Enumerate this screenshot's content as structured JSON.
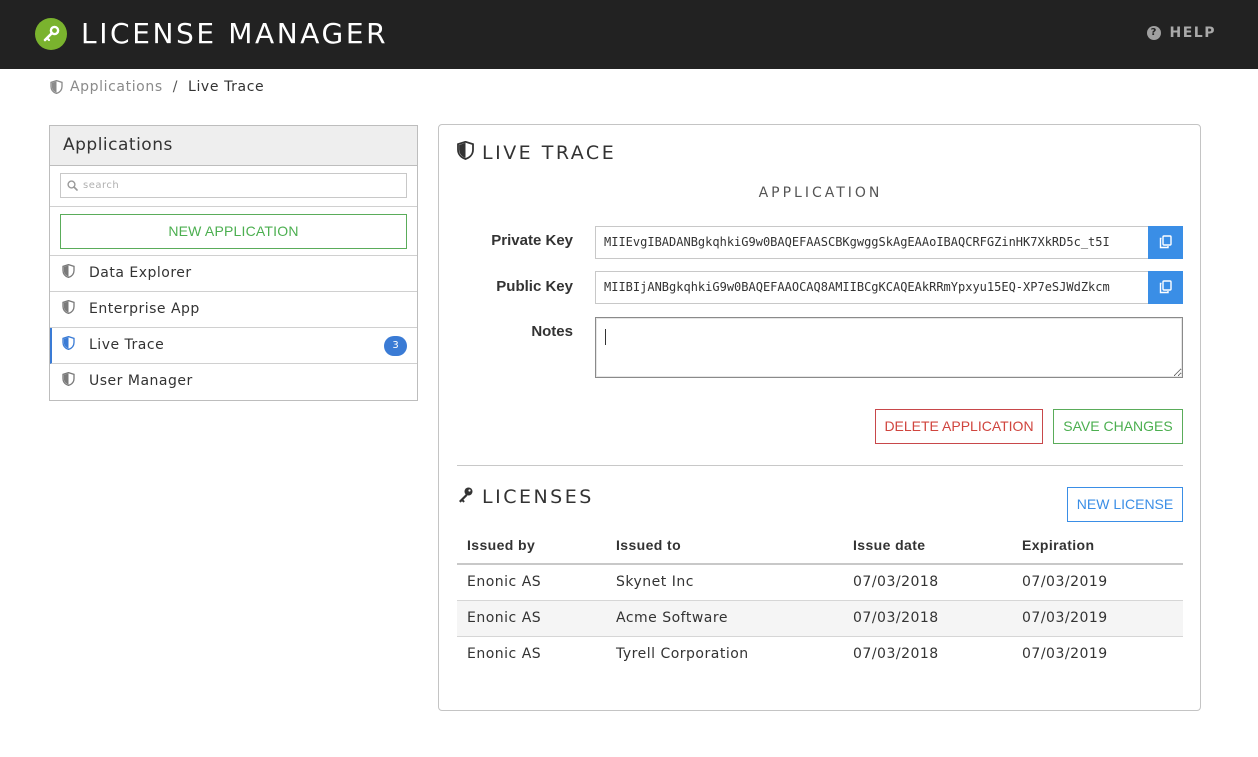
{
  "header": {
    "title": "LICENSE MANAGER",
    "logo_icon": "key-icon",
    "help_label": "HELP",
    "help_icon": "question-circle-icon",
    "background": "#222222"
  },
  "breadcrumb": {
    "icon": "shield-icon",
    "parent": "Applications",
    "separator": "/",
    "current": "Live Trace"
  },
  "sidebar": {
    "title": "Applications",
    "search_placeholder": "search",
    "new_button_label": "NEW APPLICATION",
    "items": [
      {
        "label": "Data Explorer",
        "icon": "shield-icon",
        "active": false
      },
      {
        "label": "Enterprise App",
        "icon": "shield-icon",
        "active": false
      },
      {
        "label": "Live Trace",
        "icon": "shield-icon",
        "active": true,
        "badge": "3"
      },
      {
        "label": "User Manager",
        "icon": "shield-icon",
        "active": false
      }
    ]
  },
  "main": {
    "title": "LIVE TRACE",
    "title_icon": "shield-icon",
    "section_label": "APPLICATION",
    "private_key_label": "Private Key",
    "private_key_value": "MIIEvgIBADANBgkqhkiG9w0BAQEFAASCBKgwggSkAgEAAoIBAQCRFGZinHK7XkRD5c_t5I",
    "public_key_label": "Public Key",
    "public_key_value": "MIIBIjANBgkqhkiG9w0BAQEFAAOCAQ8AMIIBCgKCAQEAkRRmYpxyu15EQ-XP7eSJWdZkcm",
    "copy_icon": "copy-icon",
    "notes_label": "Notes",
    "notes_value": "",
    "delete_label": "DELETE APPLICATION",
    "save_label": "SAVE CHANGES",
    "accent_blue": "#3a8ee6",
    "accent_green": "#4caf50",
    "accent_red": "#d0453e"
  },
  "licenses": {
    "title": "LICENSES",
    "title_icon": "key-icon",
    "new_label": "NEW LICENSE",
    "columns": [
      "Issued by",
      "Issued to",
      "Issue date",
      "Expiration"
    ],
    "rows": [
      [
        "Enonic AS",
        "Skynet Inc",
        "07/03/2018",
        "07/03/2019"
      ],
      [
        "Enonic AS",
        "Acme Software",
        "07/03/2018",
        "07/03/2019"
      ],
      [
        "Enonic AS",
        "Tyrell Corporation",
        "07/03/2018",
        "07/03/2019"
      ]
    ]
  }
}
